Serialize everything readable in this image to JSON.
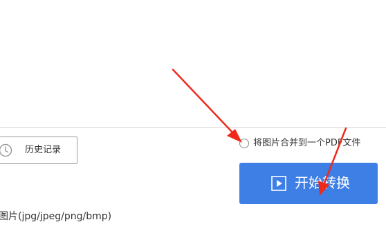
{
  "history": {
    "label": "历史记录",
    "icon": "clock-icon"
  },
  "merge_option": {
    "label": "将图片合并到一个PDF文件",
    "checked": false
  },
  "start_button": {
    "label": "开始转换",
    "icon": "play-icon"
  },
  "formats_text": "图片(jpg/jpeg/png/bmp)",
  "colors": {
    "accent": "#3e7fe5",
    "annotation_arrow": "#ee2a1c"
  }
}
